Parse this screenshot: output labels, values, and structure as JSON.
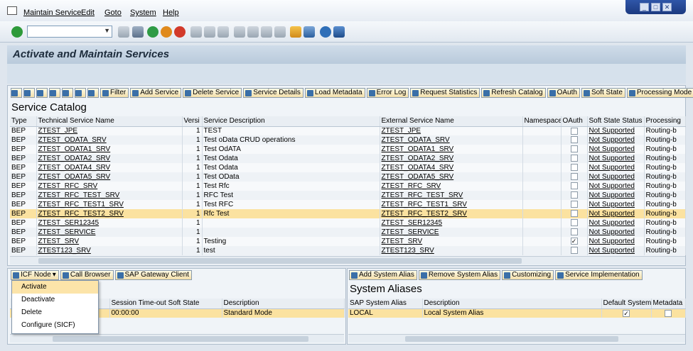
{
  "menu": [
    "Maintain Service",
    "Edit",
    "Goto",
    "System",
    "Help"
  ],
  "window_controls": [
    "_",
    "□",
    "✕"
  ],
  "page_title": "Activate and Maintain Services",
  "catalog": {
    "title": "Service Catalog",
    "buttons": [
      "Filter",
      "Add Service",
      "Delete Service",
      "Service Details",
      "Load Metadata",
      "Error Log",
      "Request Statistics",
      "Refresh Catalog",
      "OAuth",
      "Soft State",
      "Processing Mode"
    ],
    "columns": [
      "Type",
      "Technical Service Name",
      "Versi",
      "Service Description",
      "External Service Name",
      "Namespace",
      "OAuth",
      "Soft State Status",
      "Processing"
    ],
    "rows": [
      {
        "type": "BEP",
        "tech": "ZTEST_JPE",
        "ver": "1",
        "desc": "TEST",
        "ext": "ZTEST_JPE",
        "ns": "",
        "oauth": false,
        "soft": "Not Supported",
        "proc": "Routing-b"
      },
      {
        "type": "BEP",
        "tech": "ZTEST_ODATA_SRV",
        "ver": "1",
        "desc": "Test oData CRUD operations",
        "ext": "ZTEST_ODATA_SRV",
        "ns": "",
        "oauth": false,
        "soft": "Not Supported",
        "proc": "Routing-b"
      },
      {
        "type": "BEP",
        "tech": "ZTEST_ODATA1_SRV",
        "ver": "1",
        "desc": "Test OdATA",
        "ext": "ZTEST_ODATA1_SRV",
        "ns": "",
        "oauth": false,
        "soft": "Not Supported",
        "proc": "Routing-b"
      },
      {
        "type": "BEP",
        "tech": "ZTEST_ODATA2_SRV",
        "ver": "1",
        "desc": "Test Odata",
        "ext": "ZTEST_ODATA2_SRV",
        "ns": "",
        "oauth": false,
        "soft": "Not Supported",
        "proc": "Routing-b"
      },
      {
        "type": "BEP",
        "tech": "ZTEST_ODATA4_SRV",
        "ver": "1",
        "desc": "Test Odata",
        "ext": "ZTEST_ODATA4_SRV",
        "ns": "",
        "oauth": false,
        "soft": "Not Supported",
        "proc": "Routing-b"
      },
      {
        "type": "BEP",
        "tech": "ZTEST_ODATA5_SRV",
        "ver": "1",
        "desc": "Test OData",
        "ext": "ZTEST_ODATA5_SRV",
        "ns": "",
        "oauth": false,
        "soft": "Not Supported",
        "proc": "Routing-b"
      },
      {
        "type": "BEP",
        "tech": "ZTEST_RFC_SRV",
        "ver": "1",
        "desc": "Test Rfc",
        "ext": "ZTEST_RFC_SRV",
        "ns": "",
        "oauth": false,
        "soft": "Not Supported",
        "proc": "Routing-b"
      },
      {
        "type": "BEP",
        "tech": "ZTEST_RFC_TEST_SRV",
        "ver": "1",
        "desc": "RFC Test",
        "ext": "ZTEST_RFC_TEST_SRV",
        "ns": "",
        "oauth": false,
        "soft": "Not Supported",
        "proc": "Routing-b"
      },
      {
        "type": "BEP",
        "tech": "ZTEST_RFC_TEST1_SRV",
        "ver": "1",
        "desc": "Test RFC",
        "ext": "ZTEST_RFC_TEST1_SRV",
        "ns": "",
        "oauth": false,
        "soft": "Not Supported",
        "proc": "Routing-b"
      },
      {
        "type": "BEP",
        "tech": "ZTEST_RFC_TEST2_SRV",
        "ver": "1",
        "desc": "Rfc Test",
        "ext": "ZTEST_RFC_TEST2_SRV",
        "ns": "",
        "oauth": false,
        "soft": "Not Supported",
        "proc": "Routing-b",
        "selected": true
      },
      {
        "type": "BEP",
        "tech": "ZTEST_SER12345",
        "ver": "1",
        "desc": "",
        "ext": "ZTEST_SER12345",
        "ns": "",
        "oauth": false,
        "soft": "Not Supported",
        "proc": "Routing-b"
      },
      {
        "type": "BEP",
        "tech": "ZTEST_SERVICE",
        "ver": "1",
        "desc": "",
        "ext": "ZTEST_SERVICE",
        "ns": "",
        "oauth": false,
        "soft": "Not Supported",
        "proc": "Routing-b"
      },
      {
        "type": "BEP",
        "tech": "ZTEST_SRV",
        "ver": "1",
        "desc": "Testing",
        "ext": "ZTEST_SRV",
        "ns": "",
        "oauth": true,
        "soft": "Not Supported",
        "proc": "Routing-b"
      },
      {
        "type": "BEP",
        "tech": "ZTEST123_SRV",
        "ver": "1",
        "desc": "test",
        "ext": "ZTEST123_SRV",
        "ns": "",
        "oauth": false,
        "soft": "Not Supported",
        "proc": "Routing-b"
      }
    ]
  },
  "icf": {
    "buttons": [
      "ICF Node",
      "Call Browser",
      "SAP Gateway Client"
    ],
    "columns": [
      "Session Time-out Soft State",
      "Description"
    ],
    "row": {
      "timeout": "00:00:00",
      "desc": "Standard Mode"
    },
    "dropdown": [
      "Activate",
      "Deactivate",
      "Delete",
      "Configure (SICF)"
    ]
  },
  "aliases": {
    "title": "System Aliases",
    "buttons": [
      "Add System Alias",
      "Remove System Alias",
      "Customizing",
      "Service Implementation"
    ],
    "columns": [
      "SAP System Alias",
      "Description",
      "Default System",
      "Metadata"
    ],
    "row": {
      "alias": "LOCAL",
      "desc": "Local System Alias",
      "default": true,
      "meta": false
    }
  },
  "colors": {
    "selected_row": "#fbe2a0",
    "button_bg": "#f3deaa",
    "title_bg": "#c5d4e3"
  }
}
